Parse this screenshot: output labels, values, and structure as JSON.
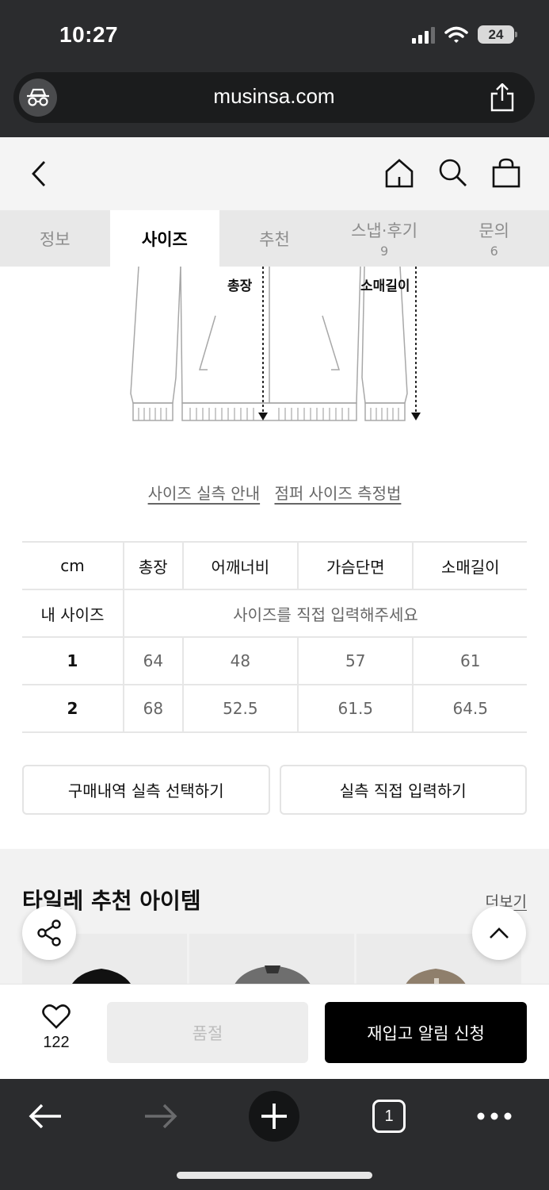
{
  "status_bar": {
    "time": "10:27",
    "battery": "24"
  },
  "browser": {
    "url": "musinsa.com",
    "tab_count": "1"
  },
  "tabs": [
    {
      "label": "정보",
      "count": ""
    },
    {
      "label": "사이즈",
      "count": ""
    },
    {
      "label": "추천",
      "count": ""
    },
    {
      "label": "스냅·후기",
      "count": "9"
    },
    {
      "label": "문의",
      "count": "6"
    }
  ],
  "diagram": {
    "length_label": "총장",
    "sleeve_label": "소매길이"
  },
  "links": {
    "guide": "사이즈 실측 안내",
    "measure": "점퍼 사이즈 측정법"
  },
  "size_table": {
    "unit": "cm",
    "headers": [
      "총장",
      "어깨너비",
      "가슴단면",
      "소매길이"
    ],
    "my_size_label": "내 사이즈",
    "my_size_prompt": "사이즈를 직접 입력해주세요",
    "rows": [
      {
        "size": "1",
        "values": [
          "64",
          "48",
          "57",
          "61"
        ]
      },
      {
        "size": "2",
        "values": [
          "68",
          "52.5",
          "61.5",
          "64.5"
        ]
      }
    ]
  },
  "actions": {
    "select_history": "구매내역 실측 선택하기",
    "direct_input": "실측 직접 입력하기"
  },
  "recommend": {
    "title": "타일레 추천 아이템",
    "more": "더보기"
  },
  "buybar": {
    "likes": "122",
    "soldout": "품절",
    "restock": "재입고 알림 신청"
  }
}
